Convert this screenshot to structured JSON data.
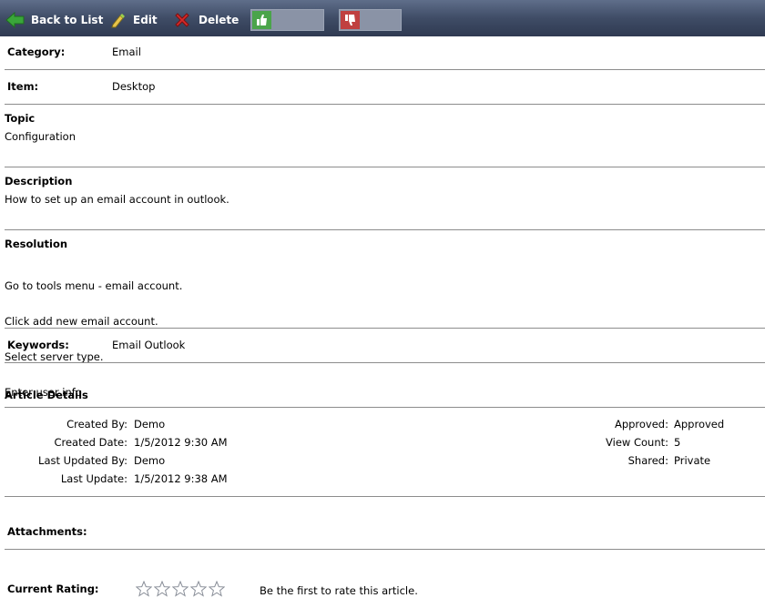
{
  "toolbar": {
    "back_label": "Back to List",
    "edit_label": "Edit",
    "delete_label": "Delete",
    "colors": {
      "background": "#3f4c66",
      "back_icon": "#3aa63a",
      "delete_icon": "#d42a2a",
      "thumb_up": "#4aa44a",
      "thumb_down": "#c04040"
    }
  },
  "fields": {
    "category_label": "Category:",
    "category_value": "Email",
    "item_label": "Item:",
    "item_value": "Desktop"
  },
  "topic": {
    "label": "Topic",
    "value": "Configuration"
  },
  "description": {
    "label": "Description",
    "value": "How to set up an email account in outlook."
  },
  "resolution": {
    "label": "Resolution",
    "lines": [
      "Go to tools menu - email account.",
      "Click add new email account.",
      "Select server type.",
      "Enter user info."
    ]
  },
  "keywords": {
    "label": "Keywords:",
    "value": "Email Outlook"
  },
  "article_details": {
    "heading": "Article Details",
    "left": [
      {
        "label": "Created By:",
        "value": "Demo"
      },
      {
        "label": "Created Date:",
        "value": "1/5/2012 9:30 AM"
      },
      {
        "label": "Last Updated By:",
        "value": "Demo"
      },
      {
        "label": "Last Update:",
        "value": "1/5/2012 9:38 AM"
      }
    ],
    "right": [
      {
        "label": "Approved:",
        "value": "Approved"
      },
      {
        "label": "View Count:",
        "value": "5"
      },
      {
        "label": "Shared:",
        "value": "Private"
      }
    ]
  },
  "attachments": {
    "label": "Attachments:"
  },
  "rating": {
    "label": "Current Rating:",
    "stars_filled": 0,
    "stars_total": 5,
    "message": "Be the first to rate this article."
  }
}
